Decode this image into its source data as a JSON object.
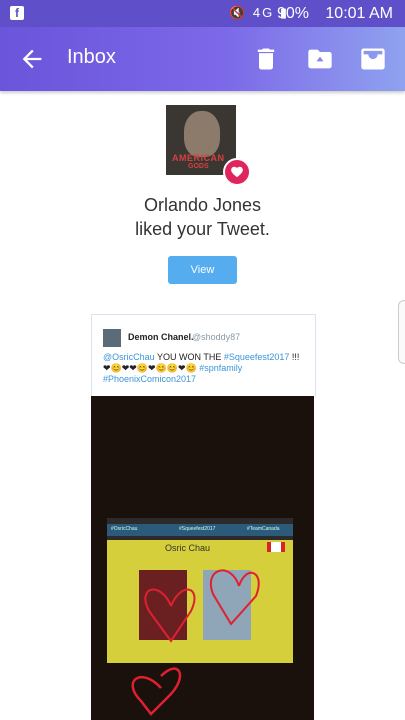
{
  "status_bar": {
    "app_icon": "facebook-icon",
    "battery": "90%",
    "time": "10:01 AM",
    "network": "4G"
  },
  "app_bar": {
    "title": "Inbox",
    "back_icon": "arrow-back-icon",
    "actions": [
      "delete-icon",
      "move-to-folder-icon",
      "archive-icon"
    ],
    "colors": {
      "start": "#6a55db",
      "end": "#8fa2ef"
    }
  },
  "notification": {
    "avatar_text_line1": "AMERICAN",
    "avatar_text_line2": "GODS",
    "line1": "Orlando Jones",
    "line2": "liked your Tweet.",
    "view_button": "View",
    "badge_color": "#e0245e"
  },
  "tweet": {
    "name": "Demon Chanel.",
    "handle": "@shoddy87",
    "mention": "@OsricChau",
    "text_part": " YOU WON THE ",
    "hashtag1": "#Squeefest2017",
    "exclaim": " !!!",
    "emoji_row": "❤😊❤❤😊❤😊😊❤😊",
    "hashtag2": "#spnfamily",
    "hashtag3": "#PhoenixComicon2017"
  },
  "photo": {
    "slide_title": "Osric Chau",
    "slide_band_left": "#OsricChau",
    "slide_band_mid": "#Squeefest2017",
    "slide_band_right": "#TeamCanada"
  }
}
